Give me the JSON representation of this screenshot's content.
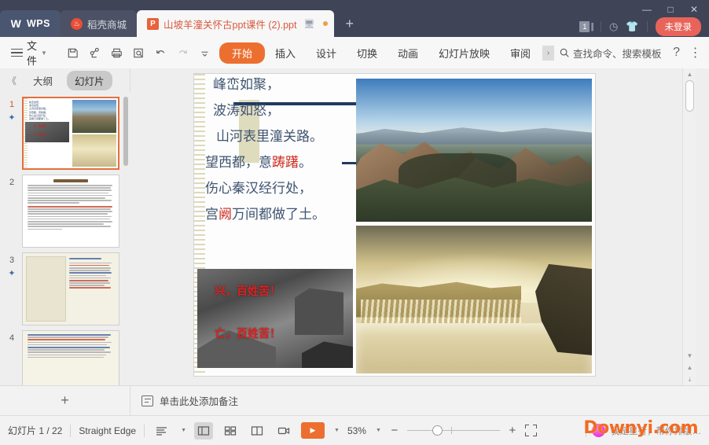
{
  "titlebar": {
    "tabs": [
      {
        "label": "WPS",
        "icon": "wps-logo-icon",
        "type": "wps"
      },
      {
        "label": "稻壳商城",
        "icon": "shop-flame-icon",
        "type": "shop"
      },
      {
        "label": "山坡羊潼关怀古ppt课件 (2).ppt",
        "icon": "ppt-file-icon",
        "type": "doc"
      }
    ],
    "new_tab_label": "+",
    "doc_count": "1",
    "right_icons": [
      "sync-icon",
      "skin-shirt-icon"
    ],
    "login_label": "未登录",
    "window_controls": {
      "minimize": "—",
      "maximize": "□",
      "close": "✕"
    }
  },
  "ribbon": {
    "file_label": "文件",
    "quick_access": [
      "save-icon",
      "share-icon",
      "print-icon",
      "print-preview-icon",
      "undo-icon",
      "redo-icon",
      "customize-qat-icon"
    ],
    "tabs": [
      {
        "label": "开始",
        "selected": true
      },
      {
        "label": "插入",
        "selected": false
      },
      {
        "label": "设计",
        "selected": false
      },
      {
        "label": "切换",
        "selected": false
      },
      {
        "label": "动画",
        "selected": false
      },
      {
        "label": "幻灯片放映",
        "selected": false
      },
      {
        "label": "审阅",
        "selected": false
      }
    ],
    "more_tabs_label": "›",
    "search_placeholder": "查找命令、搜索模板",
    "help_label": "?",
    "overflow_label": "⋮",
    "collapse_label": "⌄"
  },
  "sidebar": {
    "collapse_label": "《",
    "tabs": [
      {
        "label": "大纲",
        "selected": false
      },
      {
        "label": "幻灯片",
        "selected": true
      }
    ],
    "thumbnails": [
      {
        "number": "1",
        "selected": true,
        "has_animation": true,
        "kind": "slide1"
      },
      {
        "number": "2",
        "selected": false,
        "has_animation": false,
        "kind": "doc",
        "title": "元曲简介"
      },
      {
        "number": "3",
        "selected": false,
        "has_animation": true,
        "kind": "portrait"
      },
      {
        "number": "4",
        "selected": false,
        "has_animation": false,
        "kind": "doc2"
      }
    ]
  },
  "slide": {
    "poem_lines": [
      {
        "text": "峰峦如聚，",
        "indent": "ind"
      },
      {
        "text": "波涛如怒，",
        "indent": "ind"
      },
      {
        "text": "山河表里潼关路。",
        "indent": "ind2"
      },
      {
        "text": "望西都，意踌躇。",
        "indent": "flat",
        "red": "踌躇"
      },
      {
        "text": "伤心秦汉经行处，",
        "indent": "flat"
      },
      {
        "text": "宫阙万间都做了土。",
        "indent": "flat",
        "red": "阙"
      }
    ],
    "overlay_texts": [
      "兴，百姓苦！",
      "亡，百姓苦！"
    ],
    "images": [
      {
        "name": "mountain-photo",
        "alt": "潼关山峦远景"
      },
      {
        "name": "waterfall-photo",
        "alt": "黄河壶口瀑布"
      },
      {
        "name": "old-fortress-photo",
        "alt": "潼关古城黑白照片"
      }
    ]
  },
  "notes": {
    "placeholder": "单击此处添加备注",
    "icon": "notes-icon"
  },
  "add_slide": {
    "label": "+"
  },
  "statusbar": {
    "slide_counter": "幻灯片 1 / 22",
    "theme_name": "Straight Edge",
    "view_icons": [
      {
        "name": "outline-view-icon",
        "selected": false
      },
      {
        "name": "normal-view-icon",
        "selected": true
      },
      {
        "name": "slide-sorter-icon",
        "selected": false
      },
      {
        "name": "reading-view-icon",
        "selected": false
      },
      {
        "name": "presenter-view-icon",
        "selected": false
      }
    ],
    "play_label": "▶",
    "zoom_level": "53%",
    "zoom_minus": "−",
    "zoom_plus": "+",
    "fit_icon": "fit-to-window-icon",
    "promo_text": "我是星行，帮你排版…",
    "watermark": "Downyi.com"
  },
  "scrollbar": {
    "up_arrow": "▲",
    "down_arrow": "▼",
    "prev_slide": "▲",
    "next_slide": "▼"
  },
  "colors": {
    "titlebar_bg": "#3f4456",
    "accent_orange": "#ec6f2f",
    "login_red": "#e8645a",
    "poem_blue": "#3f5470",
    "highlight_red": "#cf2a1d",
    "watermark_orange": "#f26a21"
  }
}
